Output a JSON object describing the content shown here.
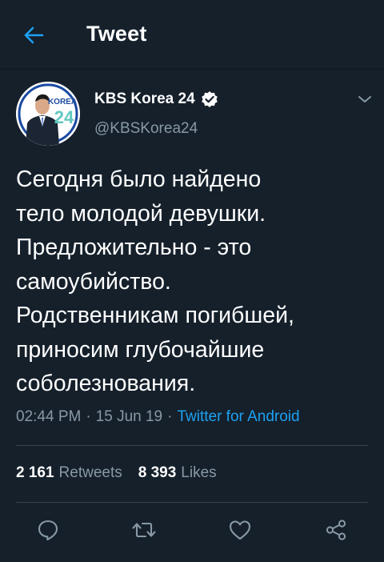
{
  "header": {
    "title": "Tweet"
  },
  "author": {
    "name": "KBS Korea 24",
    "handle": "@KBSKorea24",
    "avatar_text_top": "KOREA",
    "avatar_text_bottom": "24",
    "verified": true
  },
  "tweet": {
    "text": "Сегодня было найдено\nтело молодой девушки.\nПредложительно - это\nсамоубийство.\nРодственникам погибшей,\nприносим глубочайшие\nсоболезнования."
  },
  "meta": {
    "time": "02:44 PM",
    "separator": "·",
    "date": "15 Jun 19",
    "source": "Twitter for Android"
  },
  "stats": {
    "retweets_count": "2 161",
    "retweets_label": "Retweets",
    "likes_count": "8 393",
    "likes_label": "Likes"
  },
  "icons": {
    "back": "arrow-left-icon",
    "verified": "verified-badge-icon",
    "more": "chevron-down-icon",
    "reply": "reply-icon",
    "retweet": "retweet-icon",
    "like": "heart-icon",
    "share": "share-icon"
  },
  "colors": {
    "background": "#15202b",
    "accent": "#1da1f2",
    "secondary_text": "#8899a6",
    "divider": "#38444d"
  }
}
